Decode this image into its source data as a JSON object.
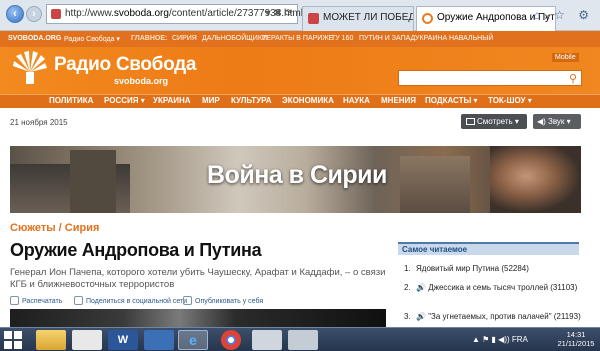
{
  "browser": {
    "url_prefix": "http://www.",
    "url_host": "svoboda.org",
    "url_path": "/content/article/27377938.html",
    "address_tools": "▾ ✖ ⟳",
    "tabs": [
      {
        "label": "МОЖЕТ ЛИ ПОБЕДИТЬ ТЕРР..."
      },
      {
        "label": "Оружие Андропова и Пути...",
        "close": "×"
      }
    ],
    "right_icons": "⌂ ☆ ⚙"
  },
  "topstrip": {
    "site": "SVOBODA.ORG",
    "brand": "Радио Свобода ▾",
    "main": "ГЛАВНОЕ:",
    "links": [
      "СИРИЯ",
      "ДАЛЬНОБОЙЩИКИ",
      "ТЕРАКТЫ В ПАРИЖЕ",
      "ТУ 160",
      "ПУТИН И ЗАПАД",
      "УКРАИНА",
      "НАВАЛЬНЫЙ"
    ]
  },
  "header": {
    "title": "Радио Свобода",
    "subtitle": "svoboda.org",
    "mobile_label": "Mobile",
    "search_placeholder": ""
  },
  "nav": {
    "items": [
      "ПОЛИТИКА",
      "РОССИЯ ▾",
      "УКРАИНА",
      "МИР",
      "КУЛЬТУРА",
      "ЭКОНОМИКА",
      "НАУКА",
      "МНЕНИЯ",
      "ПОДКАСТЫ ▾",
      "ТОК-ШОУ ▾"
    ]
  },
  "meta": {
    "date": "21 ноября 2015",
    "watch_label": "Смотреть ▾",
    "sound_label": "Звук ▾"
  },
  "banner": {
    "title": "Война в Сирии"
  },
  "article": {
    "breadcrumb": "Сюжеты / Сирия",
    "title": "Оружие Андропова и Путина",
    "lead": "Генерал Ион Пачепа, которого хотели убить Чаушеску, Арафат и Каддафи, – о связи КГБ и ближневосточных террористов",
    "share": {
      "print": "Распечатать",
      "social": "Поделиться в социальной сети",
      "publish": "Опубликовать у себя"
    }
  },
  "sidebar": {
    "most_read_title": "Самое читаемое",
    "items": [
      {
        "num": "1.",
        "speaker": "",
        "text": "Ядовитый мир Путина (52284)"
      },
      {
        "num": "2.",
        "speaker": "🔊",
        "text": "Джессика и семь тысяч троллей (31103)"
      },
      {
        "num": "3.",
        "speaker": "🔊",
        "text": "\"За угнетаемых, против палачей\" (21193)"
      }
    ]
  },
  "taskbar": {
    "tray": "▲ ⚑ ▮ ◀)) FRA",
    "time": "14:31",
    "date": "21/11/2015"
  }
}
